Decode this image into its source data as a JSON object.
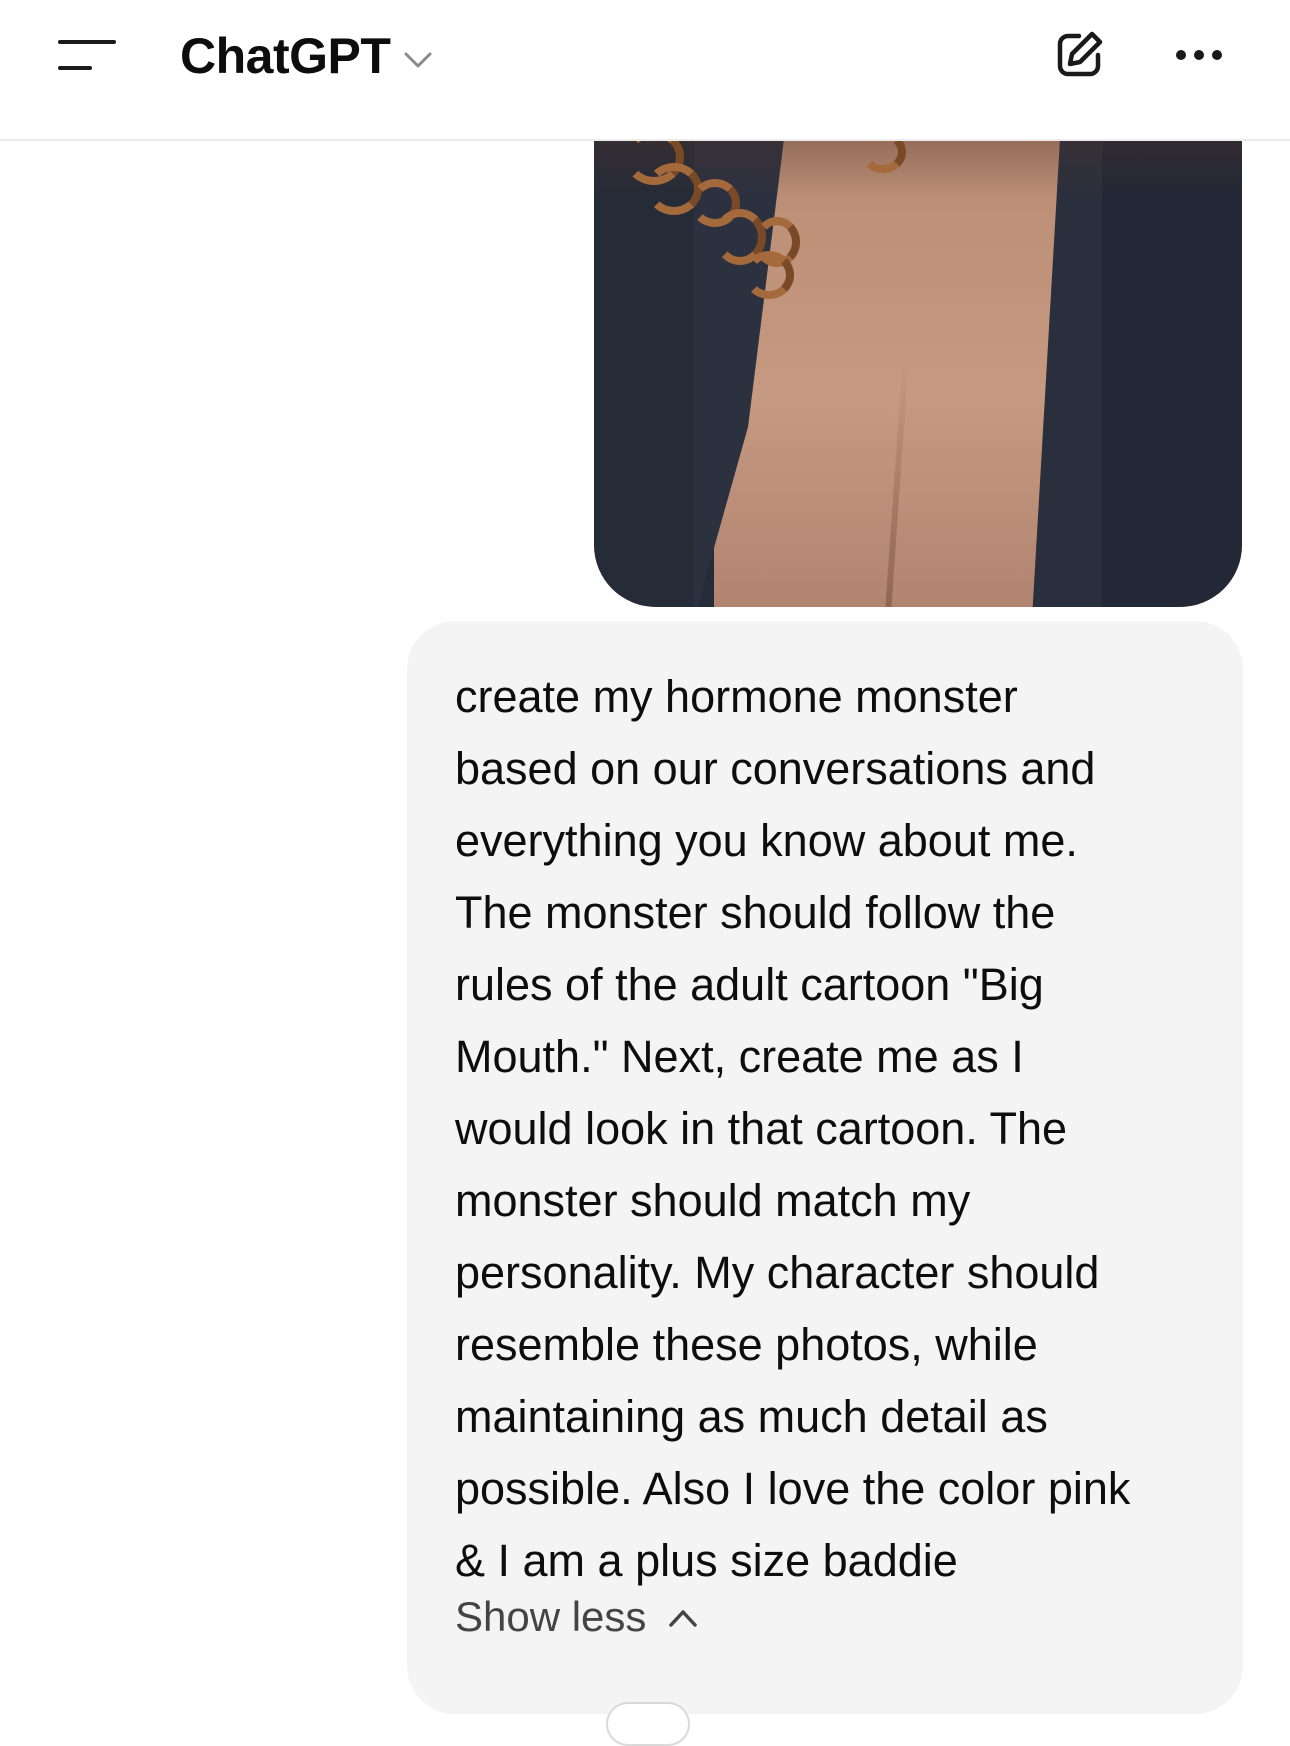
{
  "header": {
    "model_name": "ChatGPT",
    "icons": {
      "menu": "sidebar-menu-icon",
      "model_dropdown": "chevron-down-icon",
      "new_chat": "edit-icon",
      "more": "ellipsis-icon"
    }
  },
  "thread": {
    "user_attachment": {
      "kind": "photo"
    },
    "user_message": {
      "text": "create my hormone monster\nbased on our conversations and\neverything you know about me.\nThe monster should follow the\nrules of the adult cartoon \"Big\nMouth.\" Next, create me as I\nwould look in that cartoon. The\nmonster should match my\npersonality. My character should\nresemble these photos, while\nmaintaining as much detail as\npossible. Also I love the color pink\n& I am a plus size baddie",
      "toggle_label": "Show less",
      "toggle_icon": "chevron-up-icon"
    }
  },
  "colors": {
    "background": "#ffffff",
    "bubble": "#f4f4f4",
    "text": "#0d0d0d",
    "secondary_text": "#444444"
  }
}
